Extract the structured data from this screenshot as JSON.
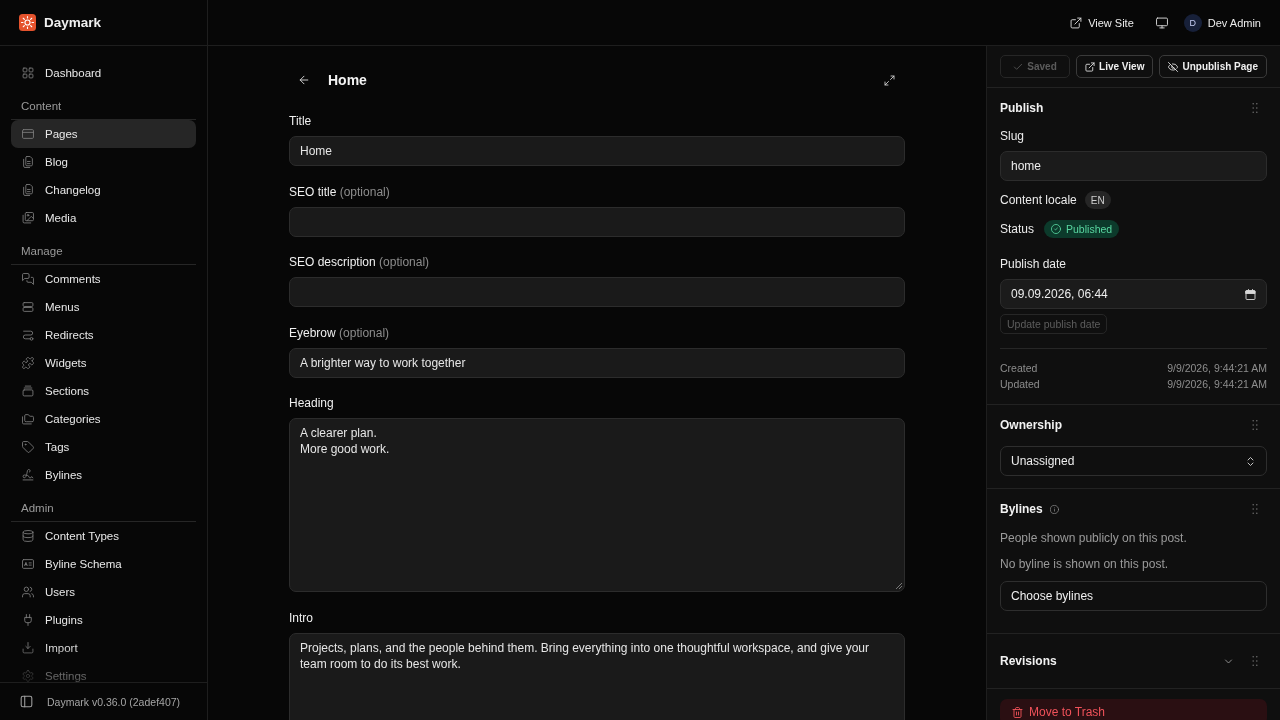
{
  "sidebar": {
    "brand": "Daymark",
    "groups": [
      {
        "items": [
          {
            "label": "Dashboard",
            "selected": false
          }
        ]
      },
      {
        "title": "Content",
        "items": [
          {
            "label": "Pages",
            "selected": true
          },
          {
            "label": "Blog",
            "selected": false
          },
          {
            "label": "Changelog",
            "selected": false
          },
          {
            "label": "Media",
            "selected": false
          }
        ]
      },
      {
        "title": "Manage",
        "items": [
          {
            "label": "Comments",
            "selected": false
          },
          {
            "label": "Menus",
            "selected": false
          },
          {
            "label": "Redirects",
            "selected": false
          },
          {
            "label": "Widgets",
            "selected": false
          },
          {
            "label": "Sections",
            "selected": false
          },
          {
            "label": "Categories",
            "selected": false
          },
          {
            "label": "Tags",
            "selected": false
          },
          {
            "label": "Bylines",
            "selected": false
          }
        ]
      },
      {
        "title": "Admin",
        "items": [
          {
            "label": "Content Types",
            "selected": false
          },
          {
            "label": "Byline Schema",
            "selected": false
          },
          {
            "label": "Users",
            "selected": false
          },
          {
            "label": "Plugins",
            "selected": false
          },
          {
            "label": "Import",
            "selected": false
          },
          {
            "label": "Settings",
            "selected": false
          }
        ]
      }
    ],
    "version": "Daymark v0.36.0 (2adef407)"
  },
  "topbar": {
    "view_site": "View Site",
    "user": {
      "initial": "D",
      "name": "Dev Admin"
    }
  },
  "editor": {
    "title": "Home",
    "fields": [
      {
        "kind": "input",
        "label": "Title",
        "value": "Home"
      },
      {
        "kind": "input",
        "label": "SEO title",
        "note": "(optional)"
      },
      {
        "kind": "input",
        "label": "SEO description",
        "note": "(optional)"
      },
      {
        "kind": "input",
        "label": "Eyebrow",
        "note": "(optional)",
        "value": "A brighter way to work together"
      },
      {
        "kind": "textarea",
        "label": "Heading",
        "value": "A clearer plan.\nMore good work."
      },
      {
        "kind": "textarea",
        "label": "Intro",
        "value": "Projects, plans, and the people behind them. Bring everything into one thoughtful workspace, and give your team room to do its best work."
      }
    ]
  },
  "panel": {
    "actions": [
      {
        "kind": "status",
        "label": "Saved",
        "disabled": true
      },
      {
        "kind": "link",
        "label": "Live View",
        "disabled": false
      },
      {
        "kind": "action",
        "label": "Unpublish Page",
        "disabled": false
      }
    ],
    "publish": {
      "title": "Publish",
      "slug": {
        "label": "Slug",
        "value": "home"
      },
      "locale": {
        "label": "Content locale",
        "value": "EN"
      },
      "status": {
        "label": "Status",
        "kind": "published",
        "value": "Published"
      },
      "date": {
        "label": "Publish date",
        "value": "09.09.2026, 06:44",
        "button": {
          "label": "Update publish date",
          "disabled": true
        }
      },
      "meta": [
        {
          "label": "Created",
          "value": "9/9/2026, 9:44:21 AM"
        },
        {
          "label": "Updated",
          "value": "9/9/2026, 9:44:21 AM"
        }
      ]
    },
    "ownership": {
      "title": "Ownership",
      "value": "Unassigned"
    },
    "bylines": {
      "title": "Bylines",
      "description": "People shown publicly on this post.",
      "empty": "No byline is shown on this post.",
      "button": "Choose bylines"
    },
    "revisions": {
      "title": "Revisions",
      "expanded": false
    },
    "trash": {
      "label": "Move to Trash"
    }
  }
}
